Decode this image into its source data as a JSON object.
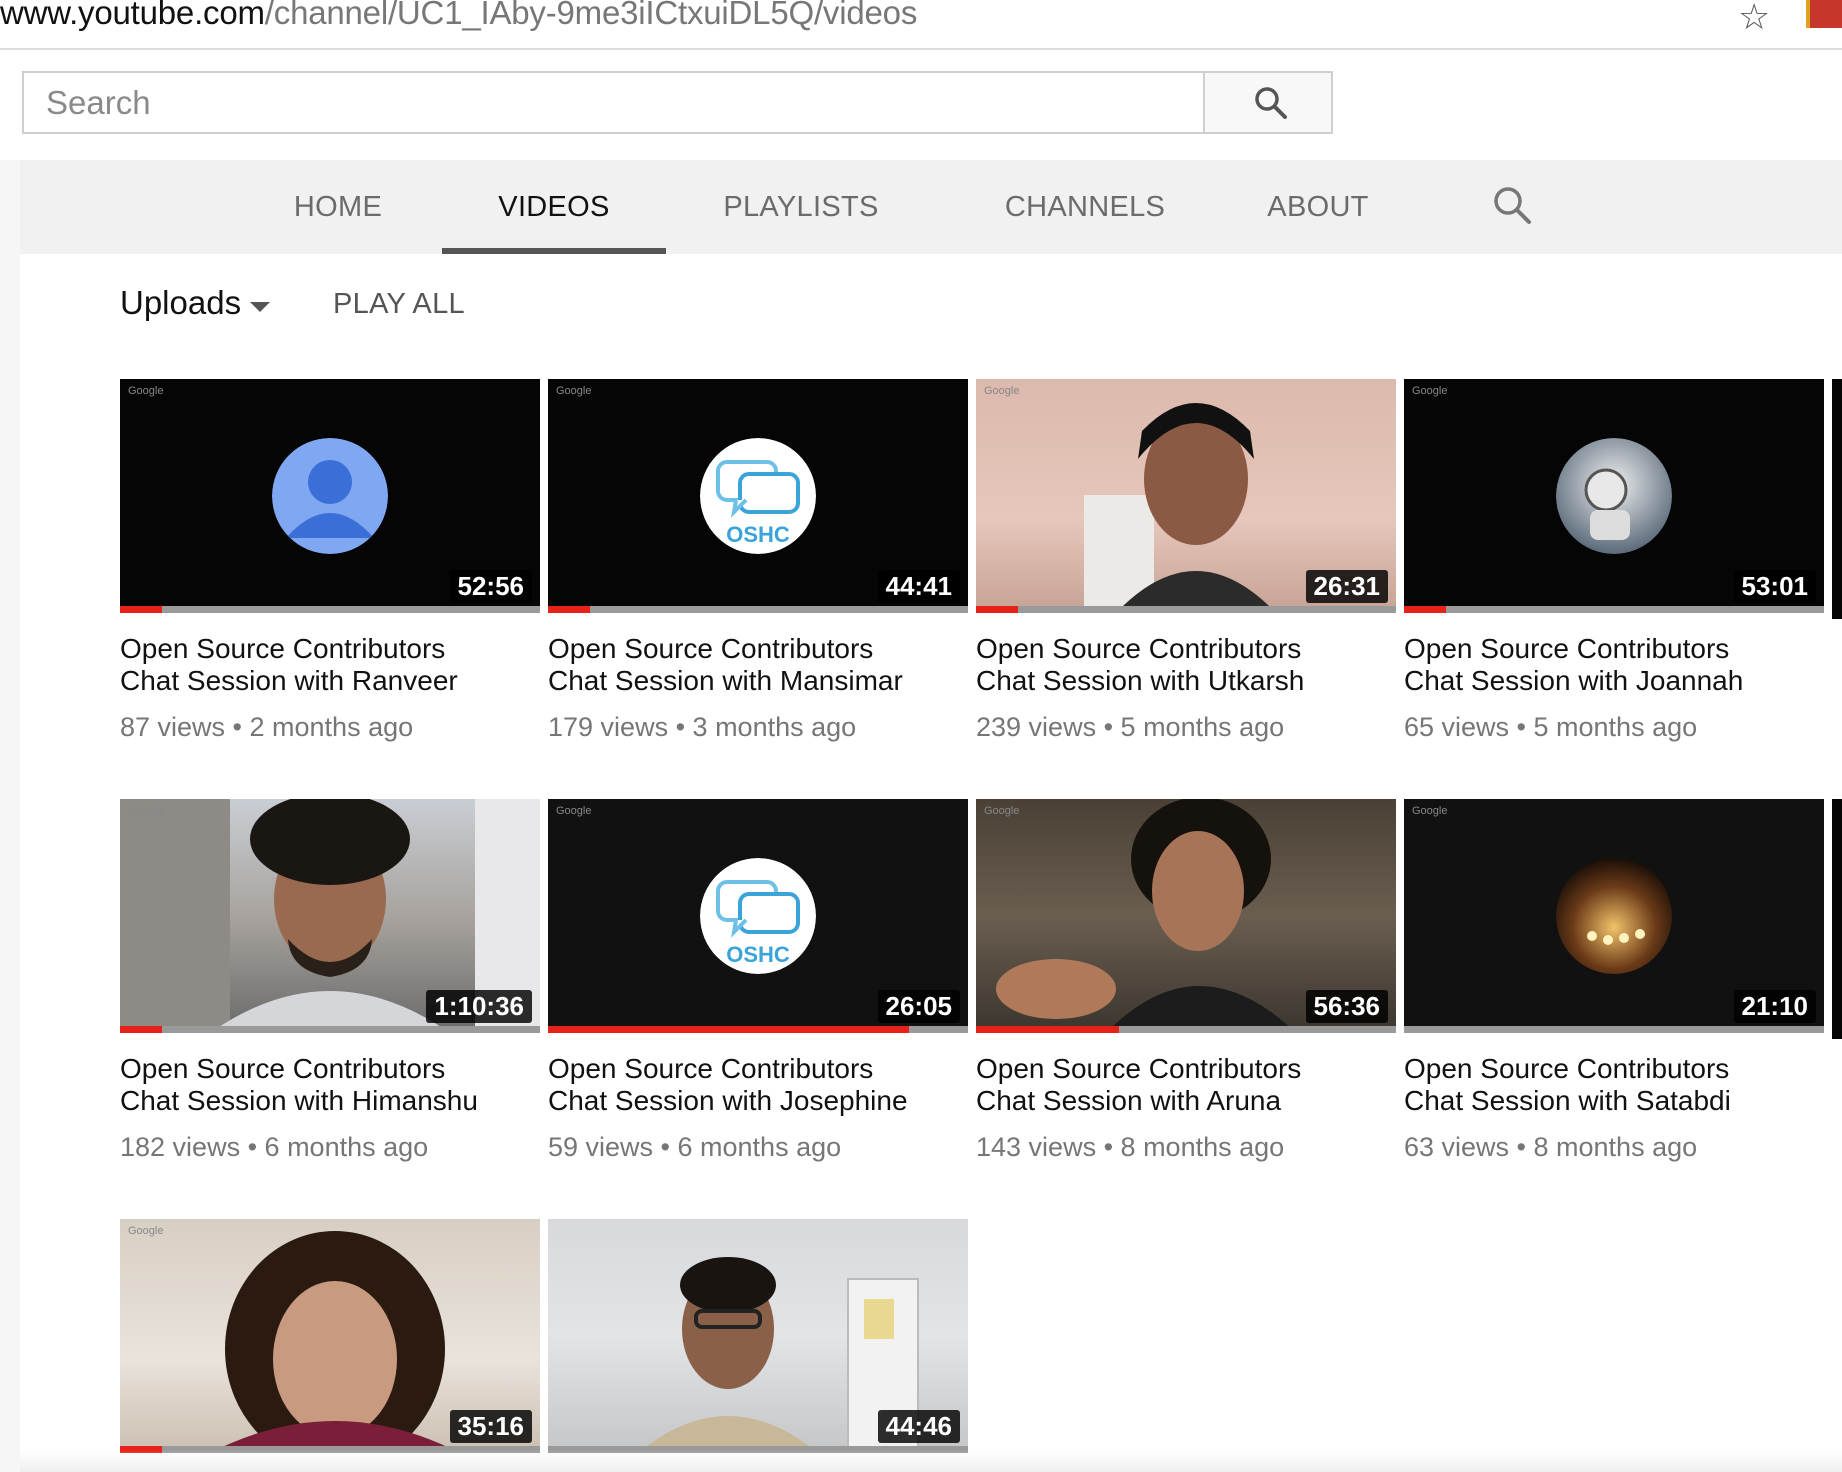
{
  "browser": {
    "url_host": "www.youtube.com",
    "url_path": "/channel/UC1_IAby-9me3iICtxuiDL5Q/videos"
  },
  "search": {
    "placeholder": "Search"
  },
  "tabs": [
    {
      "label": "HOME",
      "active": false
    },
    {
      "label": "VIDEOS",
      "active": true
    },
    {
      "label": "PLAYLISTS",
      "active": false
    },
    {
      "label": "CHANNELS",
      "active": false
    },
    {
      "label": "ABOUT",
      "active": false
    }
  ],
  "filter": {
    "label": "Uploads",
    "play_all": "PLAY ALL"
  },
  "videos": [
    {
      "title_line1": "Open Source Contributors",
      "title_line2": "Chat Session with Ranveer",
      "views": "87 views",
      "age": "2 months ago",
      "duration": "52:56",
      "watched_fraction": 0.1,
      "thumb": "person-avatar-icon"
    },
    {
      "title_line1": "Open Source Contributors",
      "title_line2": "Chat Session with Mansimar",
      "views": "179 views",
      "age": "3 months ago",
      "duration": "44:41",
      "watched_fraction": 0.1,
      "thumb": "oshc-logo",
      "logo_text": "OSHC"
    },
    {
      "title_line1": "Open Source Contributors",
      "title_line2": "Chat Session with Utkarsh",
      "views": "239 views",
      "age": "5 months ago",
      "duration": "26:31",
      "watched_fraction": 0.1,
      "thumb": "webcam-frame"
    },
    {
      "title_line1": "Open Source Contributors",
      "title_line2": "Chat Session with Joannah",
      "views": "65 views",
      "age": "5 months ago",
      "duration": "53:01",
      "watched_fraction": 0.1,
      "thumb": "profile-photo"
    },
    {
      "title_line1": "Open Source Contributors",
      "title_line2": "Chat Session with Himanshu",
      "views": "182 views",
      "age": "6 months ago",
      "duration": "1:10:36",
      "watched_fraction": 0.1,
      "thumb": "webcam-frame"
    },
    {
      "title_line1": "Open Source Contributors",
      "title_line2": "Chat Session with Josephine",
      "views": "59 views",
      "age": "6 months ago",
      "duration": "26:05",
      "watched_fraction": 0.86,
      "thumb": "oshc-logo",
      "logo_text": "OSHC"
    },
    {
      "title_line1": "Open Source Contributors",
      "title_line2": "Chat Session with Aruna",
      "views": "143 views",
      "age": "8 months ago",
      "duration": "56:36",
      "watched_fraction": 0.34,
      "thumb": "webcam-frame"
    },
    {
      "title_line1": "Open Source Contributors",
      "title_line2": "Chat Session with Satabdi",
      "views": "63 views",
      "age": "8 months ago",
      "duration": "21:10",
      "watched_fraction": 0,
      "thumb": "profile-photo"
    },
    {
      "title_line1": "",
      "title_line2": "",
      "views": "",
      "age": "",
      "duration": "35:16",
      "watched_fraction": 0.1,
      "thumb": "webcam-frame"
    },
    {
      "title_line1": "",
      "title_line2": "",
      "views": "",
      "age": "",
      "duration": "44:46",
      "watched_fraction": 0,
      "thumb": "webcam-frame"
    }
  ],
  "overlay": {
    "google_mark": "Google"
  },
  "colors": {
    "accent_red": "#e62117",
    "nav_bg": "#f1f1f1",
    "avatar_blue": "#4a86e8"
  }
}
